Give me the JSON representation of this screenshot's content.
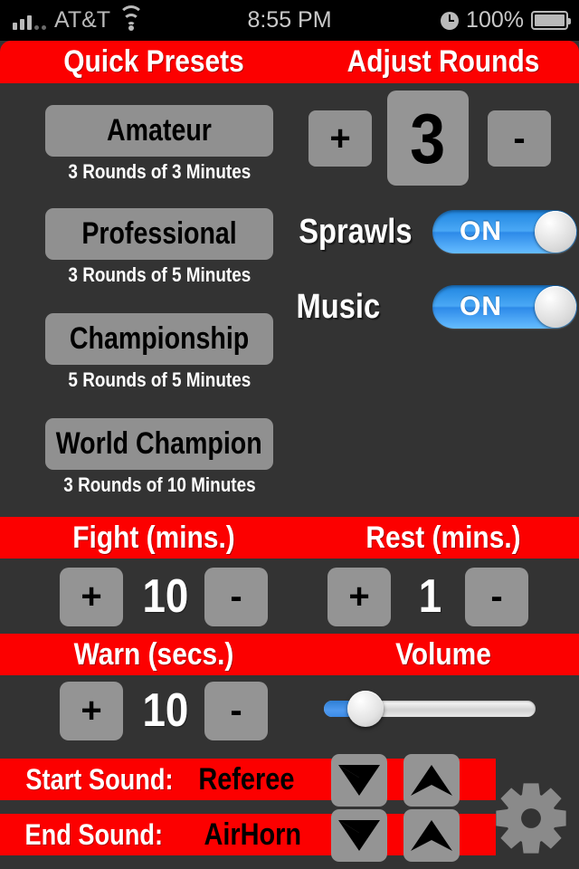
{
  "statusbar": {
    "carrier": "AT&T",
    "time": "8:55 PM",
    "battery_pct": "100%",
    "signal_icon": "signal-bars-icon",
    "wifi_icon": "wifi-icon",
    "clock_icon": "clock-icon",
    "battery_icon": "battery-full-icon"
  },
  "headers": {
    "quick_presets": "Quick Presets",
    "adjust_rounds": "Adjust Rounds",
    "fight": "Fight (mins.)",
    "rest": "Rest (mins.)",
    "warn": "Warn (secs.)",
    "volume": "Volume"
  },
  "presets": [
    {
      "name": "Amateur",
      "detail": "3 Rounds of 3 Minutes"
    },
    {
      "name": "Professional",
      "detail": "3 Rounds of 5 Minutes"
    },
    {
      "name": "Championship",
      "detail": "5 Rounds of 5 Minutes"
    },
    {
      "name": "World Champion",
      "detail": "3 Rounds of 10 Minutes"
    }
  ],
  "rounds": {
    "plus_label": "+",
    "minus_label": "-",
    "value": "3"
  },
  "toggles": [
    {
      "label": "Sprawls",
      "state": "ON"
    },
    {
      "label": "Music",
      "state": "ON"
    }
  ],
  "steppers": {
    "fight": {
      "plus_label": "+",
      "minus_label": "-",
      "value": "10"
    },
    "rest": {
      "plus_label": "+",
      "minus_label": "-",
      "value": "1"
    },
    "warn": {
      "plus_label": "+",
      "minus_label": "-",
      "value": "10"
    }
  },
  "volume": {
    "level_percent": 17
  },
  "sounds": [
    {
      "label": "Start Sound:",
      "value": "Referee",
      "down_icon": "chevron-down-icon",
      "up_icon": "chevron-up-icon"
    },
    {
      "label": "End Sound:",
      "value": "AirHorn",
      "down_icon": "chevron-down-icon",
      "up_icon": "chevron-up-icon"
    }
  ],
  "settings": {
    "icon": "gear-icon"
  },
  "colors": {
    "accent_red": "#fc0000",
    "background": "#333333",
    "button_gray": "#929292",
    "toggle_blue": "#3b8ae6",
    "status_text": "#b9b9b9"
  }
}
